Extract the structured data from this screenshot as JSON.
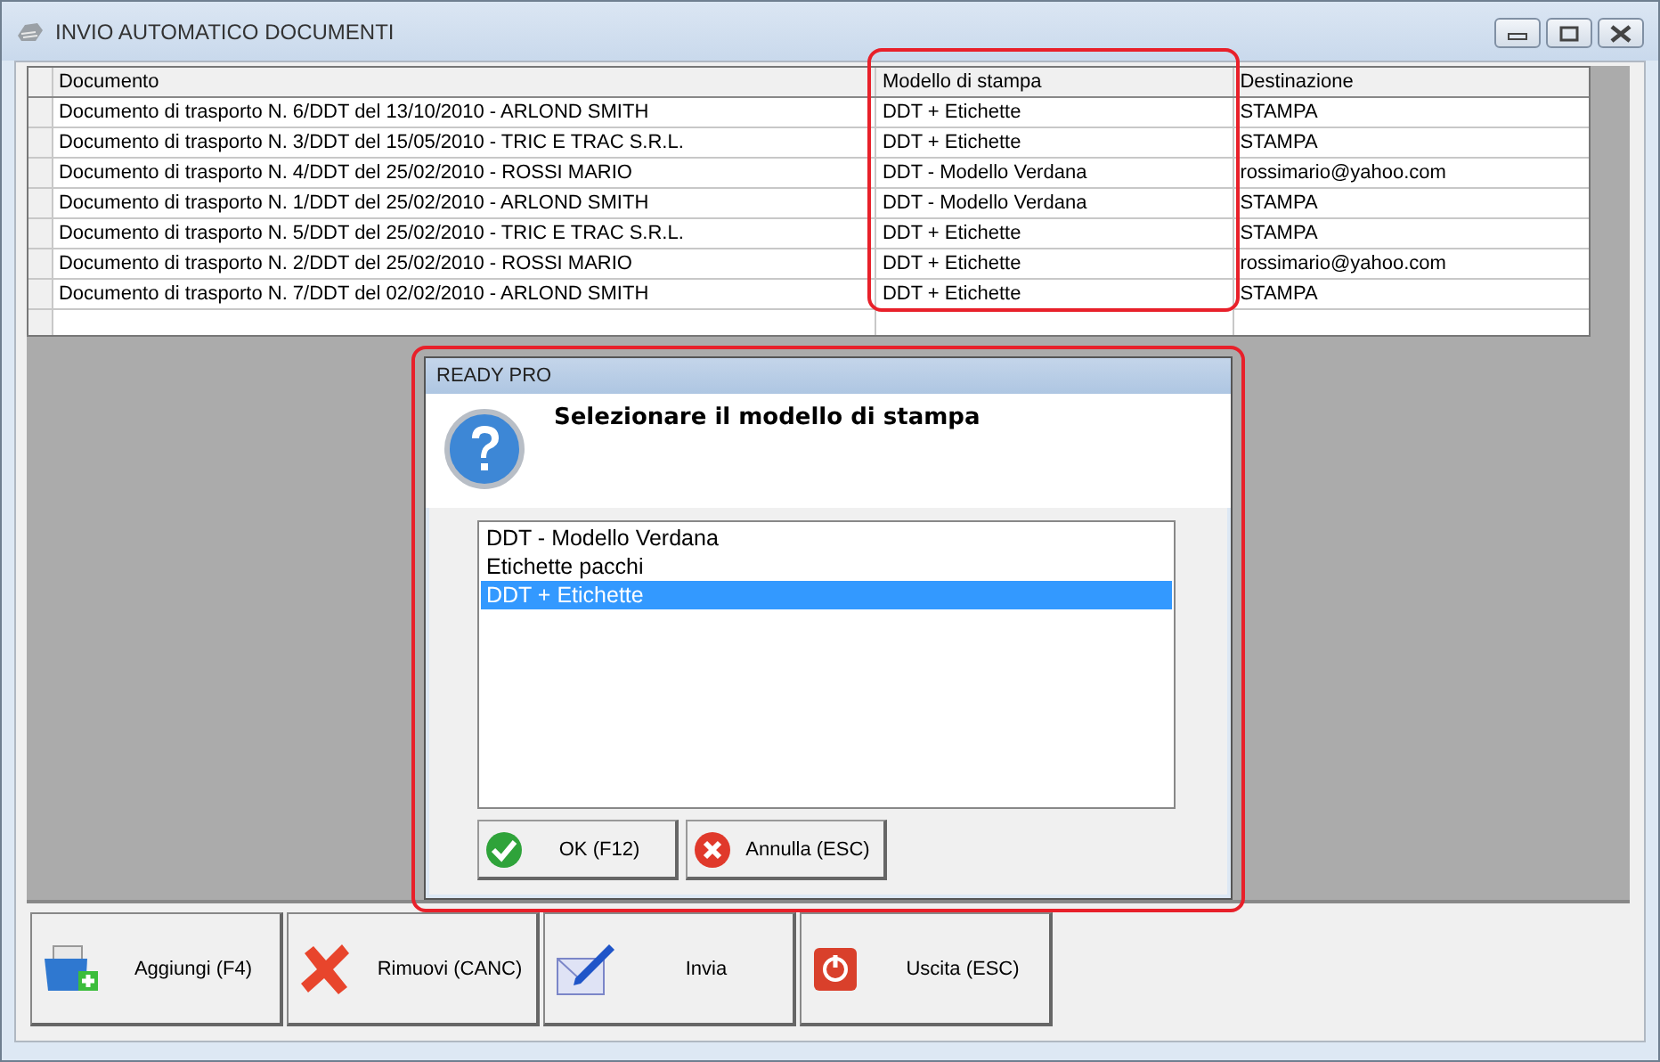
{
  "window": {
    "title": "INVIO AUTOMATICO DOCUMENTI"
  },
  "table": {
    "columns": [
      "Documento",
      "Modello di stampa",
      "Destinazione"
    ],
    "rows": [
      [
        "Documento di trasporto N. 6/DDT del 13/10/2010 - ARLOND SMITH",
        "DDT + Etichette",
        "STAMPA"
      ],
      [
        "Documento di trasporto N. 3/DDT del 15/05/2010 - TRIC E TRAC S.R.L.",
        "DDT + Etichette",
        "STAMPA"
      ],
      [
        "Documento di trasporto N. 4/DDT del 25/02/2010 - ROSSI MARIO",
        "DDT - Modello Verdana",
        "rossimario@yahoo.com"
      ],
      [
        "Documento di trasporto N. 1/DDT del 25/02/2010 - ARLOND SMITH",
        "DDT - Modello Verdana",
        "STAMPA"
      ],
      [
        "Documento di trasporto N. 5/DDT del 25/02/2010 - TRIC E TRAC S.R.L.",
        "DDT + Etichette",
        "STAMPA"
      ],
      [
        "Documento di trasporto N. 2/DDT del 25/02/2010 - ROSSI MARIO",
        "DDT + Etichette",
        "rossimario@yahoo.com"
      ],
      [
        "Documento di trasporto N. 7/DDT del 02/02/2010 - ARLOND SMITH",
        "DDT + Etichette",
        "STAMPA"
      ]
    ]
  },
  "dialog": {
    "title": "READY PRO",
    "message": "Selezionare il modello di stampa",
    "options": [
      {
        "label": "DDT - Modello Verdana",
        "selected": false
      },
      {
        "label": "Etichette pacchi",
        "selected": false
      },
      {
        "label": "DDT + Etichette",
        "selected": true
      }
    ],
    "buttons": [
      {
        "label": "OK (F12)",
        "kind": "ok"
      },
      {
        "label": "Annulla (ESC)",
        "kind": "cancel"
      }
    ]
  },
  "toolbar": [
    {
      "label": "Aggiungi (F4)",
      "kind": "add"
    },
    {
      "label": "Rimuovi (CANC)",
      "kind": "remove"
    },
    {
      "label": "Invia",
      "kind": "send"
    },
    {
      "label": "Uscita (ESC)",
      "kind": "exit"
    }
  ]
}
